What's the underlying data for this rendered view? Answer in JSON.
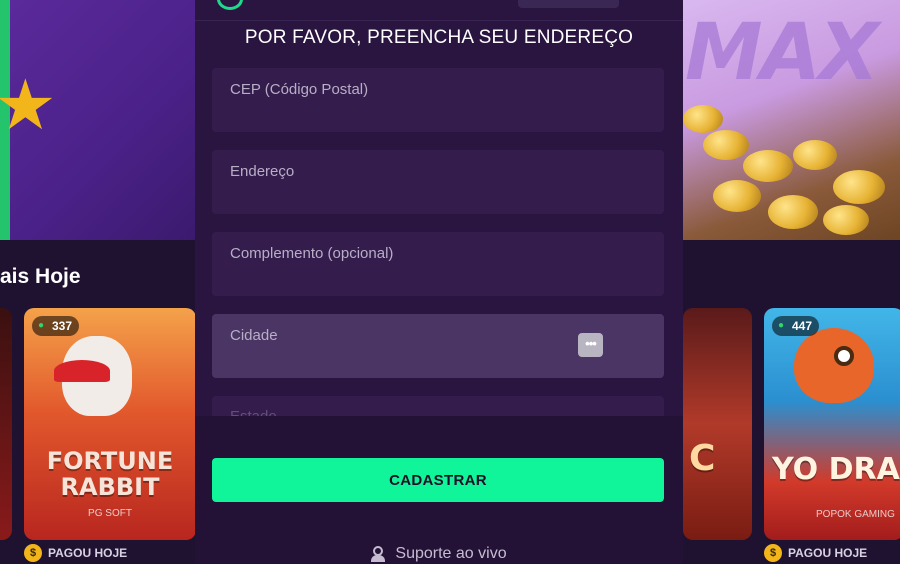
{
  "background": {
    "section_title": "ais Hoje",
    "banner_right_text": "MAX",
    "cards": [
      {
        "players": "337",
        "title_line1": "FORTUNE",
        "title_line2": "RABBIT",
        "provider": "PG SOFT"
      },
      {
        "title": "C"
      },
      {
        "players": "447",
        "title": "YO DRAGO",
        "provider": "POPOK GAMING"
      }
    ],
    "paid_labels": [
      "PAGOU HOJE",
      "PAGOU HOJE"
    ],
    "coin_symbol": "$"
  },
  "modal": {
    "title": "POR FAVOR, PREENCHA SEU ENDEREÇO",
    "fields": {
      "cep": {
        "label": "CEP (Código Postal)",
        "value": ""
      },
      "endereco": {
        "label": "Endereço",
        "value": ""
      },
      "complemento": {
        "label": "Complemento (opcional)",
        "value": ""
      },
      "cidade": {
        "label": "Cidade",
        "value": ""
      },
      "estado": {
        "label": "Estado",
        "value": ""
      }
    },
    "autofill_icon": "•••",
    "submit_label": "CADASTRAR",
    "support_label": "Suporte ao vivo"
  },
  "colors": {
    "accent": "#11f59a",
    "modal_bg": "#2a1540",
    "field_bg": "#341d4d",
    "field_active_bg": "#4a3564"
  }
}
